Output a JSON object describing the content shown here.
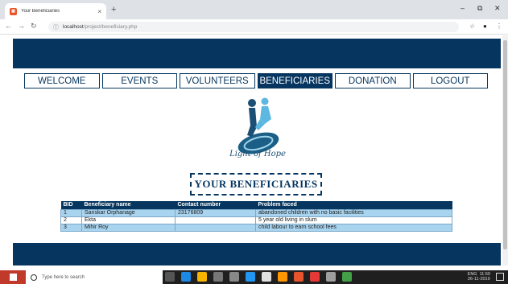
{
  "browser": {
    "tab_title": "Your Beneficiaries",
    "new_tab": "+",
    "close_tab": "×",
    "url_host": "localhost",
    "url_path": "/project/beneficiary.php",
    "win_min": "–",
    "win_max": "⧉",
    "win_close": "✕"
  },
  "nav": [
    {
      "label": "WELCOME"
    },
    {
      "label": "EVENTS"
    },
    {
      "label": "VOLUNTEERS"
    },
    {
      "label": "BENEFICIARIES"
    },
    {
      "label": "DONATION"
    },
    {
      "label": "LOGOUT"
    }
  ],
  "logo": {
    "text": "Light of Hope"
  },
  "heading": "YOUR BENEFICIARIES",
  "table": {
    "headers": [
      "BID",
      "Beneficiary name",
      "Contact number",
      "Problem faced"
    ],
    "rows": [
      [
        "1",
        "Sanskar Orphanage",
        "23176809",
        "abandoned children with no basic facilities"
      ],
      [
        "2",
        "Ekta",
        "",
        "5 year old living in slum"
      ],
      [
        "3",
        "Mihir Roy",
        "",
        "child labour to earn school fees"
      ]
    ]
  },
  "taskbar": {
    "search_placeholder": "Type here to search",
    "clock_time": "11:59",
    "clock_date": "26-11-2019",
    "lang": "ENG"
  },
  "colors": {
    "brand": "#06365f",
    "row_alt": "#a9d4ef"
  }
}
